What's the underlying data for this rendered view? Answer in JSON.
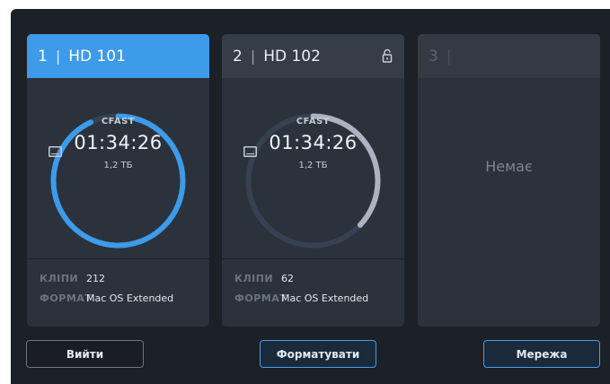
{
  "slots": [
    {
      "number": "1",
      "name": "HD 101",
      "state": "active",
      "locked": false,
      "media_type": "CFAST",
      "timecode": "01:34:26",
      "capacity": "1,2 ТБ",
      "ring_fill": 0.93,
      "clips_label": "КЛІПИ",
      "clips_value": "212",
      "format_label": "ФОРМАТ",
      "format_value": "Mac OS Extended"
    },
    {
      "number": "2",
      "name": "HD 102",
      "state": "idle",
      "locked": true,
      "media_type": "CFAST",
      "timecode": "01:34:26",
      "capacity": "1,2 ТБ",
      "ring_fill": 0.37,
      "clips_label": "КЛІПИ",
      "clips_value": "62",
      "format_label": "ФОРМАТ",
      "format_value": "Mac OS Extended"
    },
    {
      "number": "3",
      "name": "",
      "state": "empty",
      "empty_text": "Немає"
    }
  ],
  "buttons": {
    "exit": "Вийти",
    "format": "Форматувати",
    "network": "Мережа"
  },
  "colors": {
    "accent": "#3d9be9",
    "background": "#1c2027",
    "card": "#2b323c",
    "ring_track": "#364151",
    "ring_fill_idle": "#aab3bf"
  }
}
